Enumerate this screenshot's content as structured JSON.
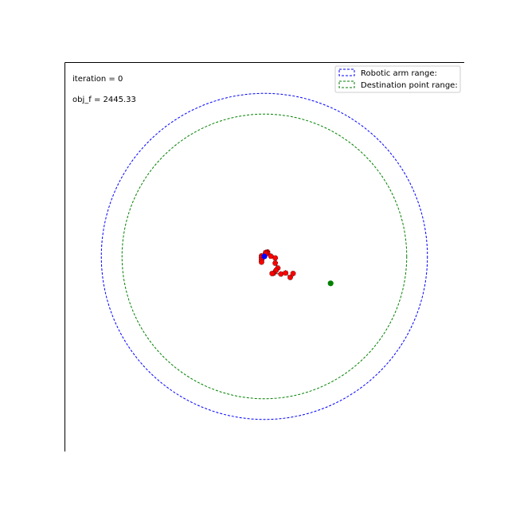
{
  "chart_data": {
    "type": "scatter",
    "title": "",
    "xlabel": "",
    "ylabel": "",
    "xlim": [
      -76.5,
      76.5
    ],
    "ylim": [
      -76.5,
      76.5
    ],
    "aspect": "equal",
    "grid": false,
    "axes_visible": [
      "left",
      "top"
    ],
    "legend_position": "top-right",
    "annotations": {
      "iteration": "iteration = 0",
      "obj_f": "obj_f = 2445.33"
    },
    "circles": [
      {
        "name": "Robotic arm range:",
        "center": [
          0,
          0
        ],
        "radius": 63,
        "color": "#0000ff",
        "linestyle": "dashed"
      },
      {
        "name": "Destination point range:",
        "center": [
          0,
          0
        ],
        "radius": 55,
        "color": "#008000",
        "linestyle": "dashed"
      }
    ],
    "series": [
      {
        "type": "line",
        "color": "#000000",
        "marker_color": "#ff0000",
        "x": [
          0,
          1.2,
          1.2,
          0.5,
          -1.1,
          -1.1,
          -1.1,
          -1.1,
          0.5,
          2.5,
          4.2,
          4.2,
          5.2,
          4.5,
          3.5,
          3.0,
          6.4,
          8.2,
          10.0,
          11.1
        ],
        "y": [
          0,
          1.7,
          1.3,
          1.5,
          0.2,
          -0.5,
          -1.4,
          -2.2,
          1.0,
          0.1,
          -0.6,
          -2.6,
          -4.5,
          -5.4,
          -6.5,
          -6.6,
          -6.8,
          -6.4,
          -8.1,
          -6.6
        ]
      }
    ],
    "points": [
      {
        "x": 0,
        "y": 0,
        "color": "#0000ff"
      },
      {
        "x": 25.6,
        "y": -10.4,
        "color": "#008000"
      }
    ]
  }
}
